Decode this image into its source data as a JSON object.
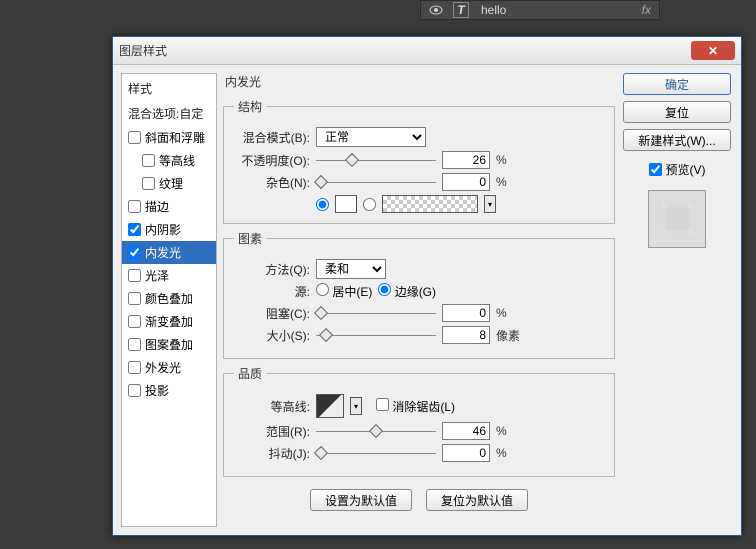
{
  "layers": {
    "name": "hello",
    "fx": "fx"
  },
  "dialog": {
    "title": "图层样式"
  },
  "sidebar": {
    "head": "样式",
    "blend": "混合选项:自定",
    "items": [
      {
        "label": "斜面和浮雕",
        "checked": false
      },
      {
        "label": "等高线",
        "checked": false,
        "sub": true
      },
      {
        "label": "纹理",
        "checked": false,
        "sub": true
      },
      {
        "label": "描边",
        "checked": false
      },
      {
        "label": "内阴影",
        "checked": true
      },
      {
        "label": "内发光",
        "checked": true,
        "selected": true
      },
      {
        "label": "光泽",
        "checked": false
      },
      {
        "label": "颜色叠加",
        "checked": false
      },
      {
        "label": "渐变叠加",
        "checked": false
      },
      {
        "label": "图案叠加",
        "checked": false
      },
      {
        "label": "外发光",
        "checked": false
      },
      {
        "label": "投影",
        "checked": false
      }
    ]
  },
  "panel": {
    "title": "内发光",
    "struct": {
      "legend": "结构",
      "blend_lbl": "混合模式(B):",
      "blend_val": "正常",
      "opacity_lbl": "不透明度(O):",
      "opacity_val": "26",
      "pct": "%",
      "noise_lbl": "杂色(N):",
      "noise_val": "0"
    },
    "elem": {
      "legend": "图素",
      "method_lbl": "方法(Q):",
      "method_val": "柔和",
      "source_lbl": "源:",
      "center": "居中(E)",
      "edge": "边缘(G)",
      "choke_lbl": "阻塞(C):",
      "choke_val": "0",
      "size_lbl": "大小(S):",
      "size_val": "8",
      "px": "像素"
    },
    "qual": {
      "legend": "品质",
      "contour_lbl": "等高线:",
      "aa": "消除锯齿(L)",
      "range_lbl": "范围(R):",
      "range_val": "46",
      "jitter_lbl": "抖动(J):",
      "jitter_val": "0"
    },
    "btn_default": "设置为默认值",
    "btn_reset": "复位为默认值"
  },
  "right": {
    "ok": "确定",
    "cancel": "复位",
    "newstyle": "新建样式(W)...",
    "preview": "预览(V)"
  }
}
